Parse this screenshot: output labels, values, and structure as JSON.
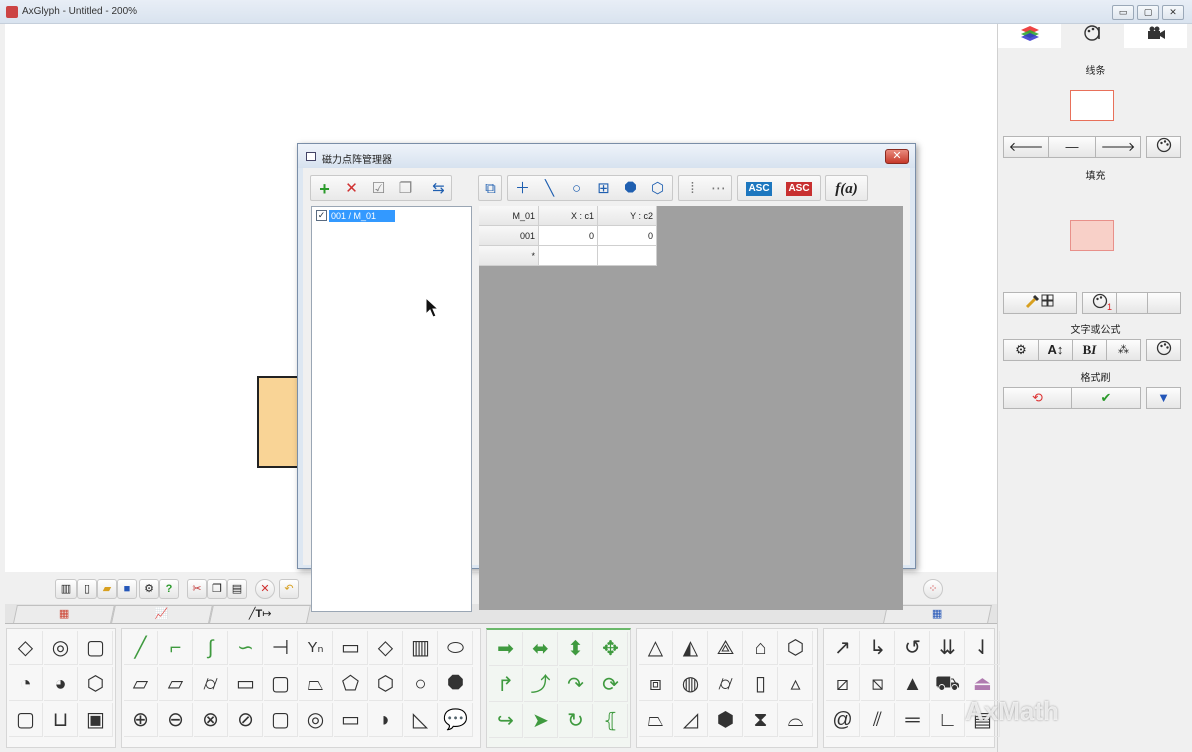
{
  "app": {
    "title": "AxGlyph - Untitled - 200%",
    "watermark": "AxMath"
  },
  "right_panel": {
    "tabs": [
      "layers-icon",
      "palette-icon",
      "camera-icon"
    ],
    "line_label": "线条",
    "line_color": "#e8705a",
    "fill_label": "填充",
    "fill_color": "#f8d0c8",
    "text_label": "文字或公式",
    "brush_label": "格式刷",
    "badge_count": "1"
  },
  "dialog": {
    "title": "磁力点阵管理器",
    "close_label": "✕",
    "list": {
      "items": [
        {
          "label": "001 / M_01",
          "checked": "✓"
        }
      ]
    },
    "table": {
      "headers": [
        "M_01",
        "X : c1",
        "Y : c2"
      ],
      "rows": [
        [
          "001",
          "0",
          "0"
        ],
        [
          "*",
          "",
          ""
        ]
      ]
    },
    "toolbar": {
      "asc1": "ASC",
      "asc2": "ASC",
      "func": "f(a)"
    }
  },
  "tabstrip": {
    "tab3": "T"
  }
}
